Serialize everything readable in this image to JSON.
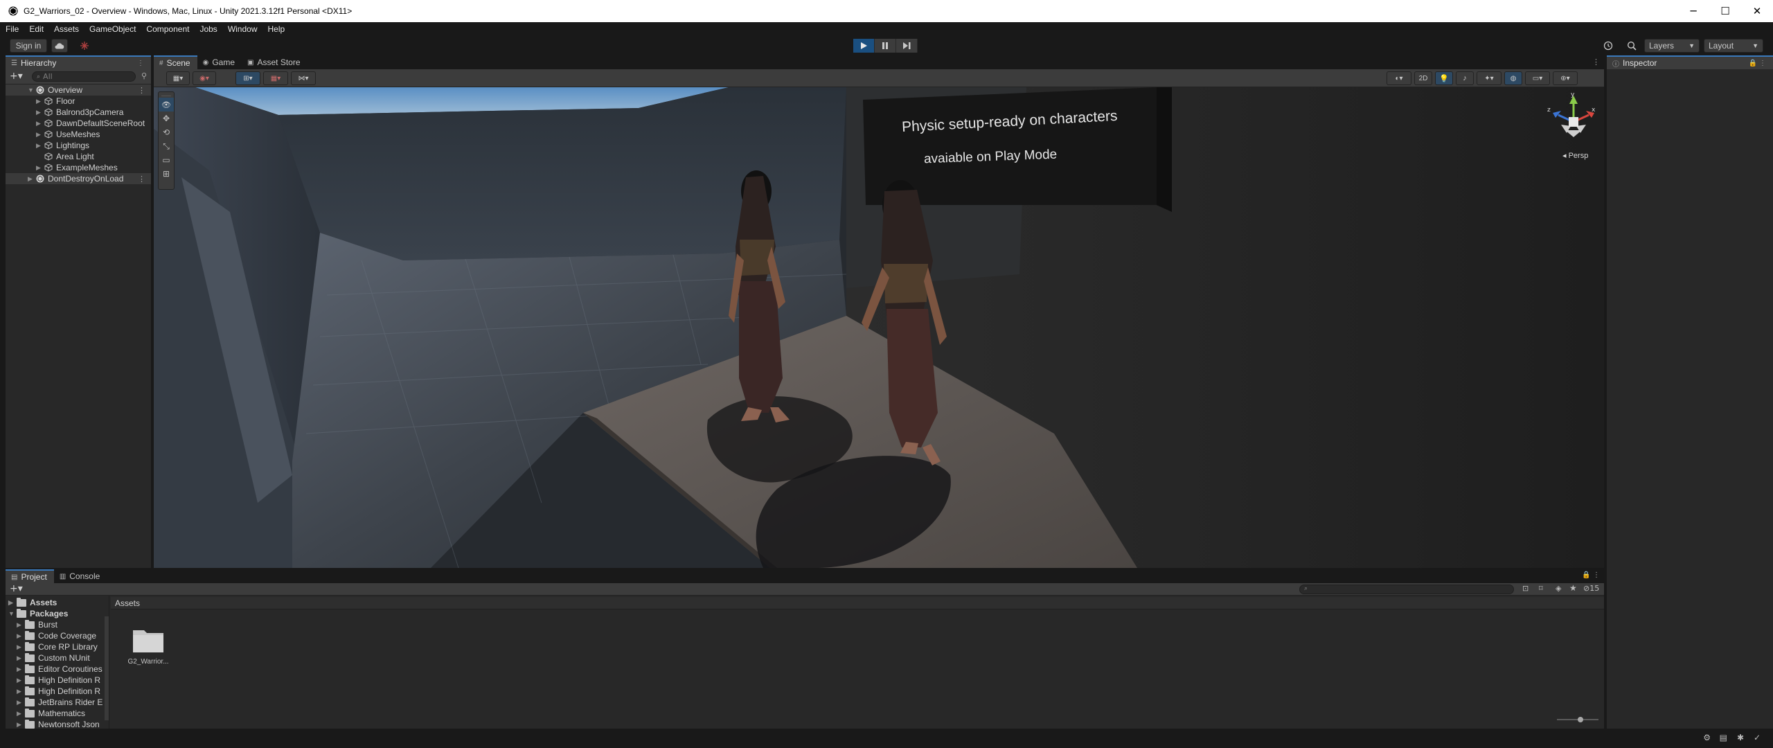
{
  "window": {
    "title": "G2_Warriors_02 - Overview - Windows, Mac, Linux - Unity 2021.3.12f1 Personal <DX11>",
    "minimize": "─",
    "maximize": "☐",
    "close": "✕"
  },
  "menu": [
    "File",
    "Edit",
    "Assets",
    "GameObject",
    "Component",
    "Jobs",
    "Window",
    "Help"
  ],
  "toolbar": {
    "sign_in": "Sign in",
    "layers": "Layers",
    "layout": "Layout"
  },
  "hierarchy": {
    "tab": "Hierarchy",
    "search_placeholder": "All",
    "scene": "Overview",
    "items": [
      "Floor",
      "Balrond3pCamera",
      "DawnDefaultSceneRoot",
      "UseMeshes",
      "Lightings",
      "Area Light",
      "ExampleMeshes"
    ],
    "dont_destroy": "DontDestroyOnLoad"
  },
  "scene": {
    "tabs": [
      "Scene",
      "Game",
      "Asset Store"
    ],
    "toggle_2d": "2D",
    "persp": "Persp",
    "gizmo_axes": {
      "y": "y",
      "x": "x",
      "z": "z"
    },
    "sign_line1": "Physic setup-ready on characters",
    "sign_line2": "avaiable on Play Mode"
  },
  "inspector": {
    "tab": "Inspector"
  },
  "project": {
    "tabs": [
      "Project",
      "Console"
    ],
    "hidden_count": "15",
    "breadcrumb": "Assets",
    "tree_assets": "Assets",
    "tree_packages": "Packages",
    "packages": [
      "Burst",
      "Code Coverage",
      "Core RP Library",
      "Custom NUnit",
      "Editor Coroutines",
      "High Definition R",
      "High Definition R",
      "JetBrains Rider E",
      "Mathematics",
      "Newtonsoft Json"
    ],
    "asset_items": [
      {
        "label": "G2_Warrior..."
      }
    ]
  },
  "colors": {
    "accent": "#3a79bb",
    "play_active": "#1a4f80",
    "panel": "#282828",
    "chrome": "#191919"
  }
}
